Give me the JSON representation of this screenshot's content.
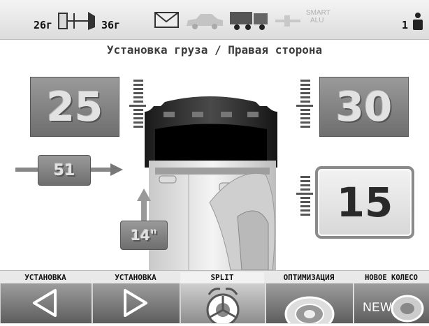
{
  "topbar": {
    "left_weight": "26г",
    "right_weight": "36г",
    "smart_label": "SMART",
    "alu_label": "ALU",
    "operator": "1"
  },
  "title": "Установка груза / Правая сторона",
  "weights": {
    "left_value": "25",
    "right_value": "30",
    "split_value": "15"
  },
  "rim": {
    "offset_value": "51",
    "diameter_value": "14\""
  },
  "buttons": [
    {
      "label": "УСТАНОВКА",
      "icon": "arrow-left-icon"
    },
    {
      "label": "УСТАНОВКА",
      "icon": "arrow-right-icon"
    },
    {
      "label": "SPLIT",
      "icon": "split-wheel-icon"
    },
    {
      "label": "ОПТИМИЗАЦИЯ",
      "icon": "optimization-wheel-icon"
    },
    {
      "label": "НОВОЕ КОЛЕСО",
      "icon": "new-wheel-icon"
    }
  ],
  "colors": {
    "selected_button": "#cfcfcf",
    "button": "#7d7d7d"
  }
}
